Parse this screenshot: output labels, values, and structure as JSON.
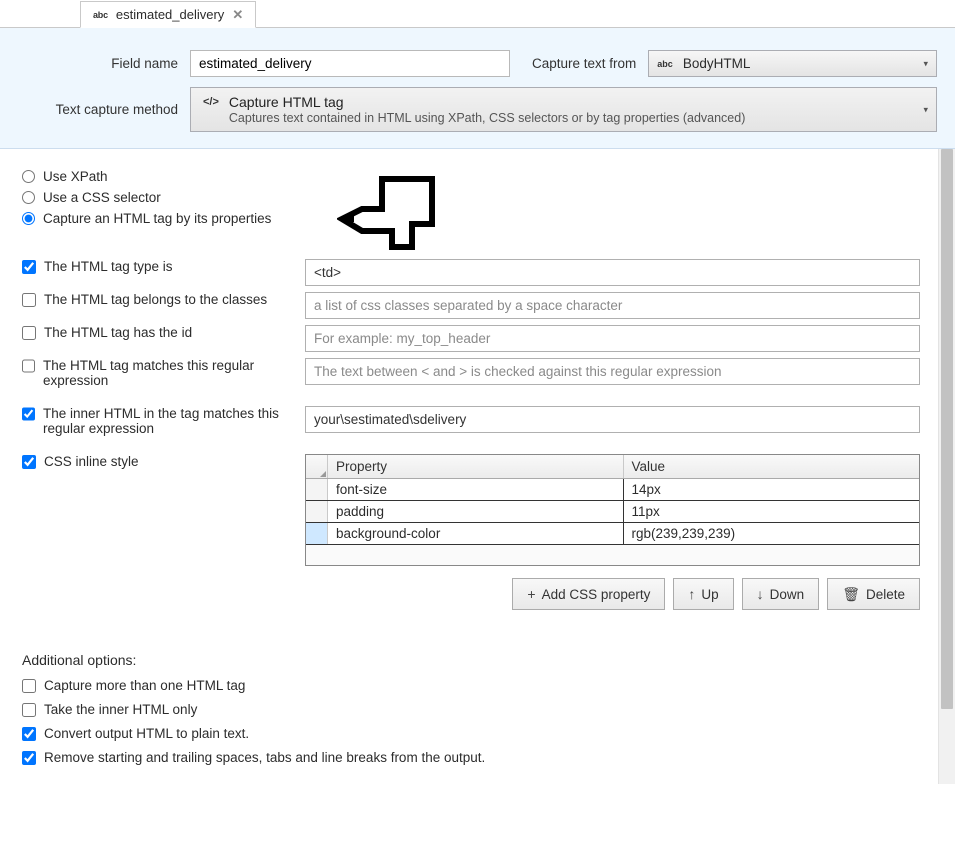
{
  "tab": {
    "prefix": "abc",
    "title": "estimated_delivery"
  },
  "header": {
    "field_name_label": "Field name",
    "field_name_value": "estimated_delivery",
    "capture_from_label": "Capture text from",
    "capture_from_prefix": "abc",
    "capture_from_value": "BodyHTML",
    "method_label": "Text capture method",
    "method_title": "Capture HTML tag",
    "method_desc": "Captures text contained in HTML using XPath, CSS selectors or by tag properties (advanced)"
  },
  "radios": {
    "xpath": "Use XPath",
    "css": "Use a CSS selector",
    "props": "Capture an HTML tag by its properties"
  },
  "props": {
    "tag_type": {
      "label": "The HTML tag type is",
      "value": "<td>"
    },
    "classes": {
      "label": "The HTML tag belongs to the classes",
      "placeholder": "a list of css classes separated by a space character"
    },
    "has_id": {
      "label": "The HTML tag has the id",
      "placeholder": "For example: my_top_header"
    },
    "regex": {
      "label": "The HTML tag matches this regular expression",
      "placeholder": "The text between < and > is checked against this regular expression"
    },
    "inner": {
      "label": "The inner HTML in the tag matches this regular expression",
      "value": "your\\sestimated\\sdelivery"
    },
    "css_style": {
      "label": "CSS inline style"
    }
  },
  "css_table": {
    "headers": {
      "prop": "Property",
      "val": "Value"
    },
    "rows": [
      {
        "prop": "font-size",
        "val": "14px"
      },
      {
        "prop": "padding",
        "val": "11px"
      },
      {
        "prop": "background-color",
        "val": "rgb(239,239,239)"
      }
    ]
  },
  "buttons": {
    "add": "Add CSS property",
    "up": "Up",
    "down": "Down",
    "delete": "Delete"
  },
  "additional": {
    "title": "Additional options:",
    "opts": [
      {
        "label": "Capture more than one HTML tag",
        "checked": false
      },
      {
        "label": "Take the inner HTML only",
        "checked": false
      },
      {
        "label": "Convert output HTML to plain text.",
        "checked": true
      },
      {
        "label": "Remove starting and trailing spaces, tabs and line breaks from the output.",
        "checked": true
      }
    ]
  }
}
